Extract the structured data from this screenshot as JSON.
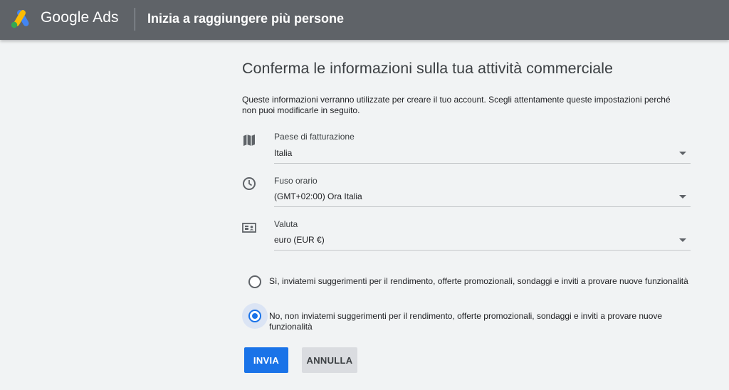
{
  "header": {
    "brand": "Google Ads",
    "page_heading": "Inizia a raggiungere più persone"
  },
  "main": {
    "title": "Conferma le informazioni sulla tua attività commerciale",
    "description": "Queste informazioni verranno utilizzate per creare il tuo account. Scegli attentamente queste impostazioni perché non puoi modificarle in seguito.",
    "fields": [
      {
        "icon": "map-icon",
        "label": "Paese di fatturazione",
        "value": "Italia"
      },
      {
        "icon": "clock-icon",
        "label": "Fuso orario",
        "value": "(GMT+02:00) Ora Italia"
      },
      {
        "icon": "currency-card-icon",
        "label": "Valuta",
        "value": "euro (EUR €)"
      }
    ],
    "options": [
      {
        "label": "Sì, inviatemi suggerimenti per il rendimento, offerte promozionali, sondaggi e inviti a provare nuove funzionalità",
        "selected": false
      },
      {
        "label": "No, non inviatemi suggerimenti per il rendimento, offerte promozionali, sondaggi e inviti a provare nuove funzionalità",
        "selected": true
      }
    ],
    "buttons": {
      "submit": "INVIA",
      "cancel": "ANNULLA"
    }
  },
  "colors": {
    "topbar": "#5f6368",
    "background": "#f1f3f4",
    "accent": "#1a73e8",
    "ads_yellow": "#fbbc04",
    "ads_blue": "#4285f4",
    "ads_green": "#34a853"
  }
}
